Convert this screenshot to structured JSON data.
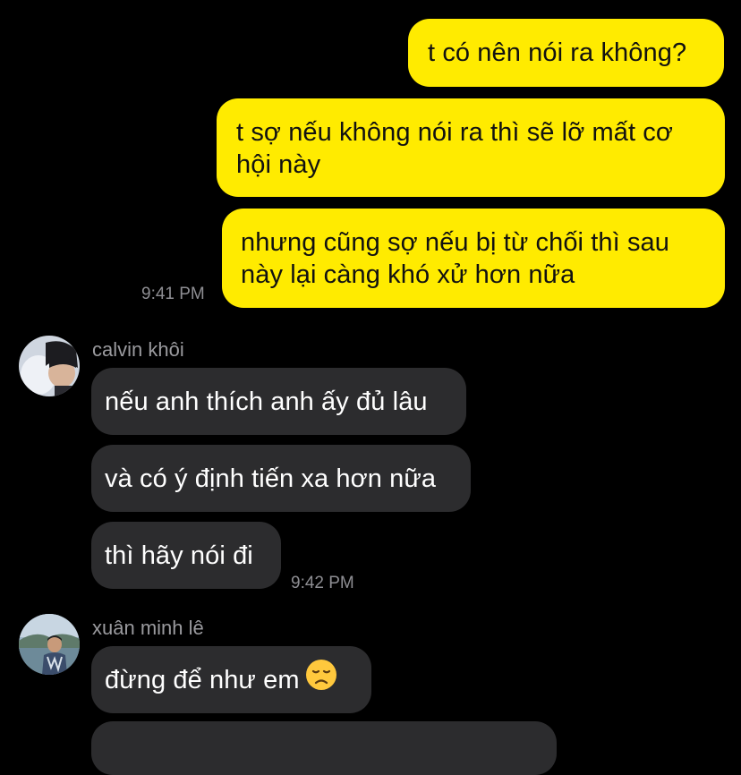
{
  "colors": {
    "background": "#000000",
    "outgoing_bubble": "#FFEB00",
    "incoming_bubble": "#2C2C2E",
    "timestamp": "#8E8E93"
  },
  "outgoing": [
    {
      "text": "t có nên nói ra không?"
    },
    {
      "text": "t sợ nếu không nói ra thì sẽ lỡ mất cơ hội này"
    },
    {
      "text": "nhưng cũng sợ nếu bị từ chối thì sau này lại càng khó xử hơn nữa"
    }
  ],
  "outgoing_time": "9:41 PM",
  "groups": [
    {
      "sender": "calvin khôi",
      "avatar_icon": "calvin-avatar",
      "messages": [
        {
          "text": "nếu anh thích anh ấy đủ lâu"
        },
        {
          "text": "và có ý định tiến xa hơn nữa"
        },
        {
          "text": "thì hãy nói đi"
        }
      ],
      "time": "9:42 PM"
    },
    {
      "sender": "xuân minh lê",
      "avatar_icon": "xuan-minh-avatar",
      "messages": [
        {
          "text": "đừng để như em",
          "emoji": "disappointed-face-icon"
        }
      ]
    }
  ]
}
